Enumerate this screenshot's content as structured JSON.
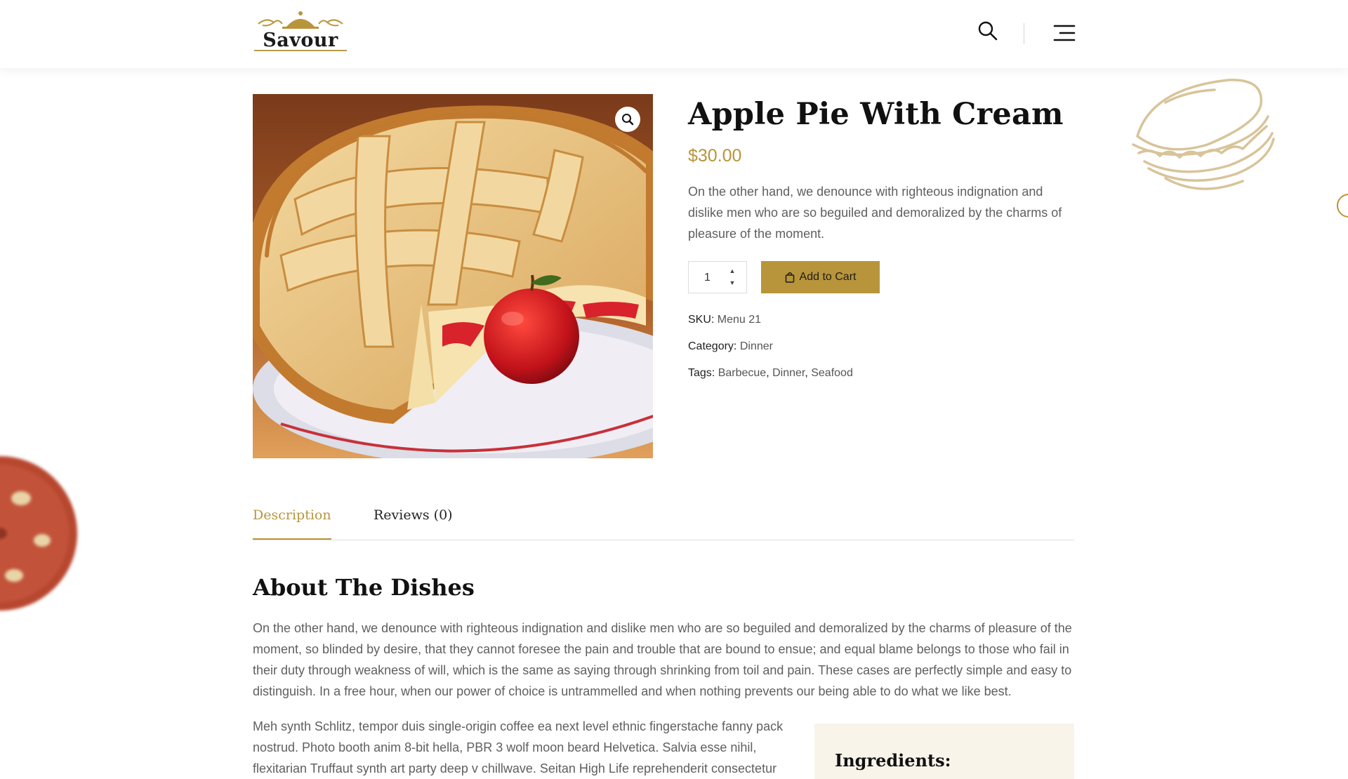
{
  "header": {
    "logo_text": "Savour"
  },
  "product": {
    "title": "Apple Pie With Cream",
    "price": "$30.00",
    "description": "On the other hand, we denounce with righteous indignation and dislike men who are so beguiled and demoralized by the charms of pleasure of the moment.",
    "quantity": "1",
    "add_to_cart_label": "Add to Cart",
    "sku_label": "SKU:",
    "sku_value": "Menu 21",
    "category_label": "Category:",
    "category_value": "Dinner",
    "tags_label": "Tags:",
    "tags": [
      "Barbecue",
      "Dinner",
      "Seafood"
    ]
  },
  "tabs": [
    {
      "label": "Description",
      "active": true
    },
    {
      "label": "Reviews (0)",
      "active": false
    }
  ],
  "content": {
    "about_title": "About The Dishes",
    "about_text": "On the other hand, we denounce with righteous indignation and dislike men who are so beguiled and demoralized by the charms of pleasure of the moment, so blinded by desire, that they cannot foresee the pain and trouble that are bound to ensue; and equal blame belongs to those who fail in their duty through weakness of will, which is the same as saying through shrinking from toil and pain. These cases are perfectly simple and easy to distinguish. In a free hour, when our power of choice is untrammelled and when nothing prevents our being able to do what we like best.",
    "second_text": "Meh synth Schlitz, tempor duis single-origin coffee ea next level ethnic fingerstache fanny pack nostrud. Photo booth anim 8-bit hella, PBR 3 wolf moon beard Helvetica. Salvia esse nihil, flexitarian Truffaut synth art party deep v chillwave. Seitan High Life reprehenderit consectetur",
    "ingredients_title": "Ingredients:"
  },
  "colors": {
    "accent": "#b8953a",
    "heading": "#111111",
    "body_text": "#5f5f5f",
    "ingredients_bg": "#f8f4ea"
  },
  "icons": [
    "cloche-logo-icon",
    "search-icon",
    "hamburger-menu-icon",
    "zoom-icon",
    "bag-icon",
    "caret-up-icon",
    "caret-down-icon",
    "sandwich-illustration",
    "pizza-illustration"
  ]
}
